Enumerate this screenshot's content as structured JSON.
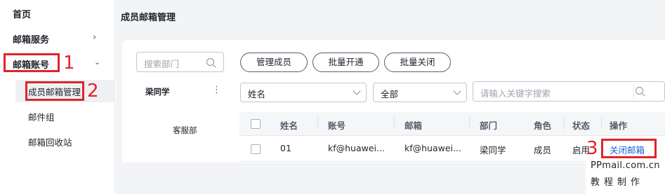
{
  "sidebar": {
    "items": [
      {
        "label": "首页"
      },
      {
        "label": "邮箱服务",
        "chevron": "chevron-right-icon"
      },
      {
        "label": "邮箱账号",
        "chevron": "chevron-down-icon",
        "expanded": true
      }
    ],
    "sub_items": [
      {
        "label": "成员邮箱管理",
        "selected": true
      },
      {
        "label": "邮件组"
      },
      {
        "label": "邮箱回收站"
      }
    ]
  },
  "main": {
    "page_title": "成员邮箱管理",
    "dept_search_placeholder": "搜索部门",
    "dept_tree": {
      "root": "梁同学",
      "more": "⋮",
      "child": "客服部"
    },
    "buttons": [
      "管理成员",
      "批量开通",
      "批量关闭"
    ],
    "filters": {
      "field_select": "姓名",
      "status_select": "全部",
      "keyword_placeholder": "请输入关键字搜索"
    },
    "table": {
      "columns": [
        "姓名",
        "账号",
        "邮箱",
        "部门",
        "角色",
        "状态",
        "操作"
      ],
      "rows": [
        {
          "name": "01",
          "account": "kf@huawei...",
          "email": "kf@huawei...",
          "dept": "梁同学",
          "role": "成员",
          "status": "启用",
          "action": "关闭邮箱"
        }
      ]
    }
  },
  "annotations": {
    "marker1": "1",
    "marker2": "2",
    "marker3": "3",
    "color": "#e0242a"
  },
  "watermark": {
    "line1": "PPmail.com.cn",
    "line2": "教程制作"
  }
}
